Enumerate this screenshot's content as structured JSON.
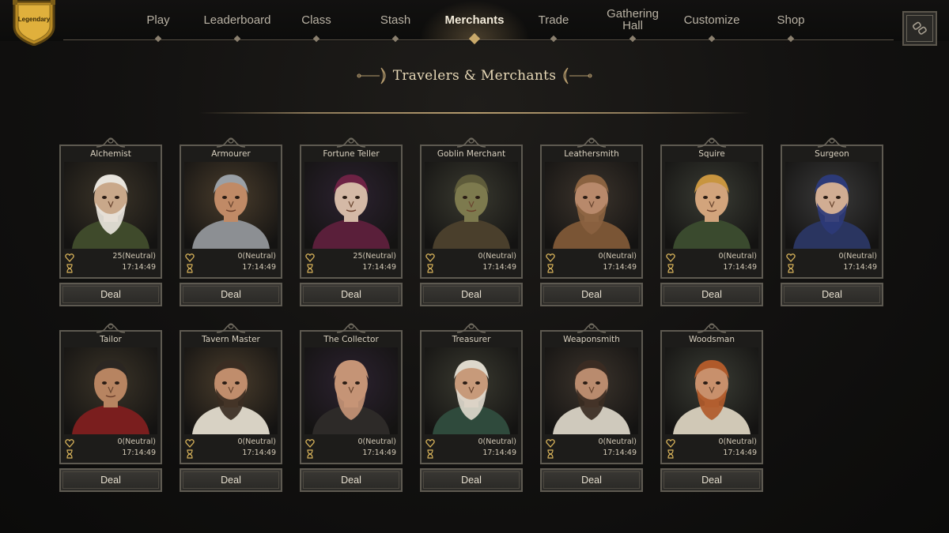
{
  "rank_badge": {
    "label": "Legendary"
  },
  "nav": {
    "items": [
      {
        "label": "Play",
        "active": false
      },
      {
        "label": "Leaderboard",
        "active": false
      },
      {
        "label": "Class",
        "active": false
      },
      {
        "label": "Stash",
        "active": false
      },
      {
        "label": "Merchants",
        "active": true
      },
      {
        "label": "Trade",
        "active": false
      },
      {
        "label": "Gathering Hall",
        "active": false
      },
      {
        "label": "Customize",
        "active": false
      },
      {
        "label": "Shop",
        "active": false
      }
    ]
  },
  "page": {
    "title": "Travelers & Merchants"
  },
  "merchants": [
    {
      "name": "Alchemist",
      "affinity": "25(Neutral)",
      "timer": "17:14:49",
      "deal_label": "Deal",
      "skin": "#c9a88a",
      "cloth": "#3f4a2b",
      "hair": "#e8e4dc",
      "beard": true
    },
    {
      "name": "Armourer",
      "affinity": "0(Neutral)",
      "timer": "17:14:49",
      "deal_label": "Deal",
      "skin": "#c08a66",
      "cloth": "#8c8f93",
      "hair": "#9aa0a6",
      "beard": false
    },
    {
      "name": "Fortune Teller",
      "affinity": "25(Neutral)",
      "timer": "17:14:49",
      "deal_label": "Deal",
      "skin": "#d4b9a6",
      "cloth": "#5a1f3a",
      "hair": "#6d2244",
      "beard": false
    },
    {
      "name": "Goblin Merchant",
      "affinity": "0(Neutral)",
      "timer": "17:14:49",
      "deal_label": "Deal",
      "skin": "#7d7a4e",
      "cloth": "#4a3f2c",
      "hair": "#5e5b3a",
      "beard": false
    },
    {
      "name": "Leathersmith",
      "affinity": "0(Neutral)",
      "timer": "17:14:49",
      "deal_label": "Deal",
      "skin": "#b8896b",
      "cloth": "#7a5535",
      "hair": "#8a6240",
      "beard": true
    },
    {
      "name": "Squire",
      "affinity": "0(Neutral)",
      "timer": "17:14:49",
      "deal_label": "Deal",
      "skin": "#d2a47c",
      "cloth": "#3a4a2e",
      "hair": "#c8953f",
      "beard": false
    },
    {
      "name": "Surgeon",
      "affinity": "0(Neutral)",
      "timer": "17:14:49",
      "deal_label": "Deal",
      "skin": "#d1ad93",
      "cloth": "#2a3560",
      "hair": "#2c3a78",
      "beard": true
    },
    {
      "name": "Tailor",
      "affinity": "0(Neutral)",
      "timer": "17:14:49",
      "deal_label": "Deal",
      "skin": "#b78461",
      "cloth": "#7a1e1e",
      "hair": "#2b2622",
      "beard": false
    },
    {
      "name": "Tavern Master",
      "affinity": "0(Neutral)",
      "timer": "17:14:49",
      "deal_label": "Deal",
      "skin": "#c08d6c",
      "cloth": "#d8d2c4",
      "hair": "#3a2c22",
      "beard": true
    },
    {
      "name": "The Collector",
      "affinity": "0(Neutral)",
      "timer": "17:14:49",
      "deal_label": "Deal",
      "skin": "#c59476",
      "cloth": "#2d2a28",
      "hair": "#c59476",
      "beard": true
    },
    {
      "name": "Treasurer",
      "affinity": "0(Neutral)",
      "timer": "17:14:49",
      "deal_label": "Deal",
      "skin": "#c79a7a",
      "cloth": "#2f4a3c",
      "hair": "#ddd8cc",
      "beard": true
    },
    {
      "name": "Weaponsmith",
      "affinity": "0(Neutral)",
      "timer": "17:14:49",
      "deal_label": "Deal",
      "skin": "#b98b6e",
      "cloth": "#cfc9bc",
      "hair": "#3a2b22",
      "beard": true
    },
    {
      "name": "Woodsman",
      "affinity": "0(Neutral)",
      "timer": "17:14:49",
      "deal_label": "Deal",
      "skin": "#c8906c",
      "cloth": "#d0c8b6",
      "hair": "#b05a2a",
      "beard": true
    }
  ]
}
